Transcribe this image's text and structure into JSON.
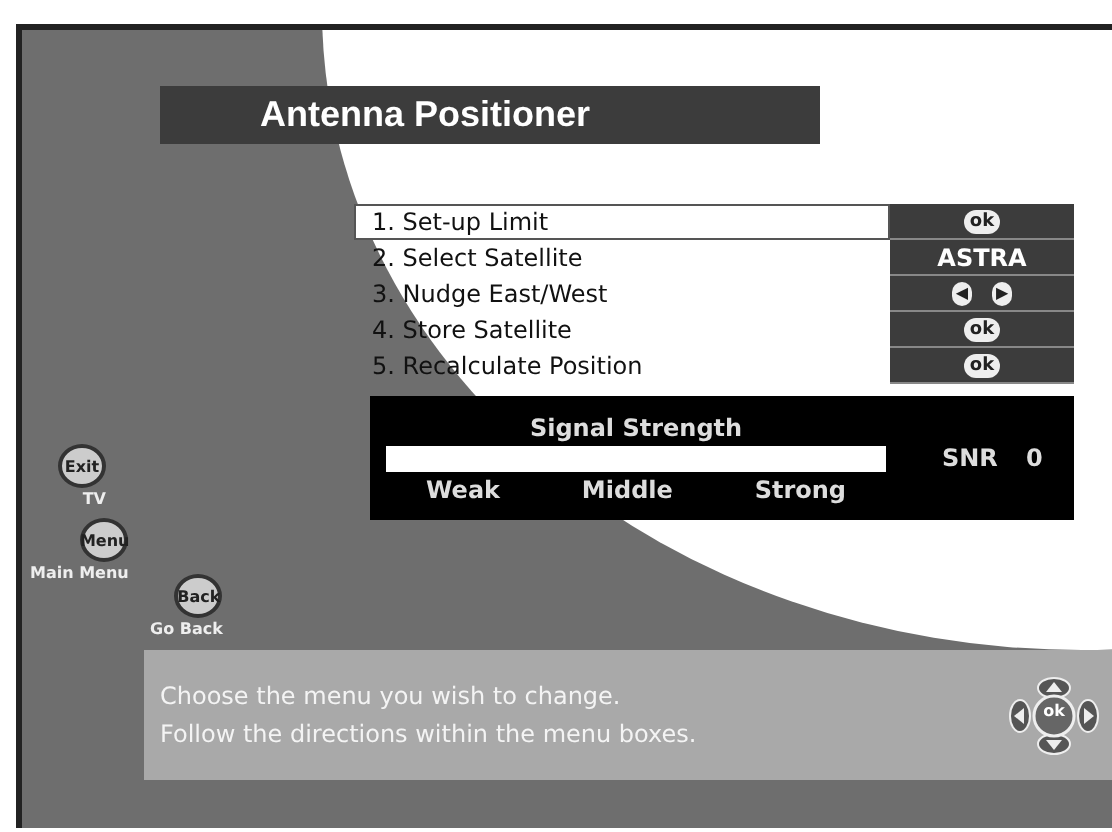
{
  "title": "Antenna Positioner",
  "menu": [
    {
      "label": "1. Set-up Limit",
      "kind": "ok",
      "value": "ok",
      "selected": true
    },
    {
      "label": "2. Select Satellite",
      "kind": "text",
      "value": "ASTRA",
      "selected": false
    },
    {
      "label": "3. Nudge East/West",
      "kind": "nudge",
      "value_left": "◀",
      "value_right": "▶",
      "selected": false
    },
    {
      "label": "4. Store Satellite",
      "kind": "ok",
      "value": "ok",
      "selected": false
    },
    {
      "label": "5. Recalculate Position",
      "kind": "ok",
      "value": "ok",
      "selected": false
    }
  ],
  "signal": {
    "title": "Signal Strength",
    "level": 0,
    "scale": [
      "Weak",
      "Middle",
      "Strong"
    ],
    "snr_label": "SNR",
    "snr_value": "0"
  },
  "nav": [
    {
      "key": "Exit",
      "label": "TV"
    },
    {
      "key": "Menu",
      "label": "Main Menu"
    },
    {
      "key": "Back",
      "label": "Go Back"
    }
  ],
  "help": [
    "Choose the menu you wish to change.",
    "Follow the directions within the menu boxes."
  ],
  "dpad": {
    "center": "ok"
  }
}
